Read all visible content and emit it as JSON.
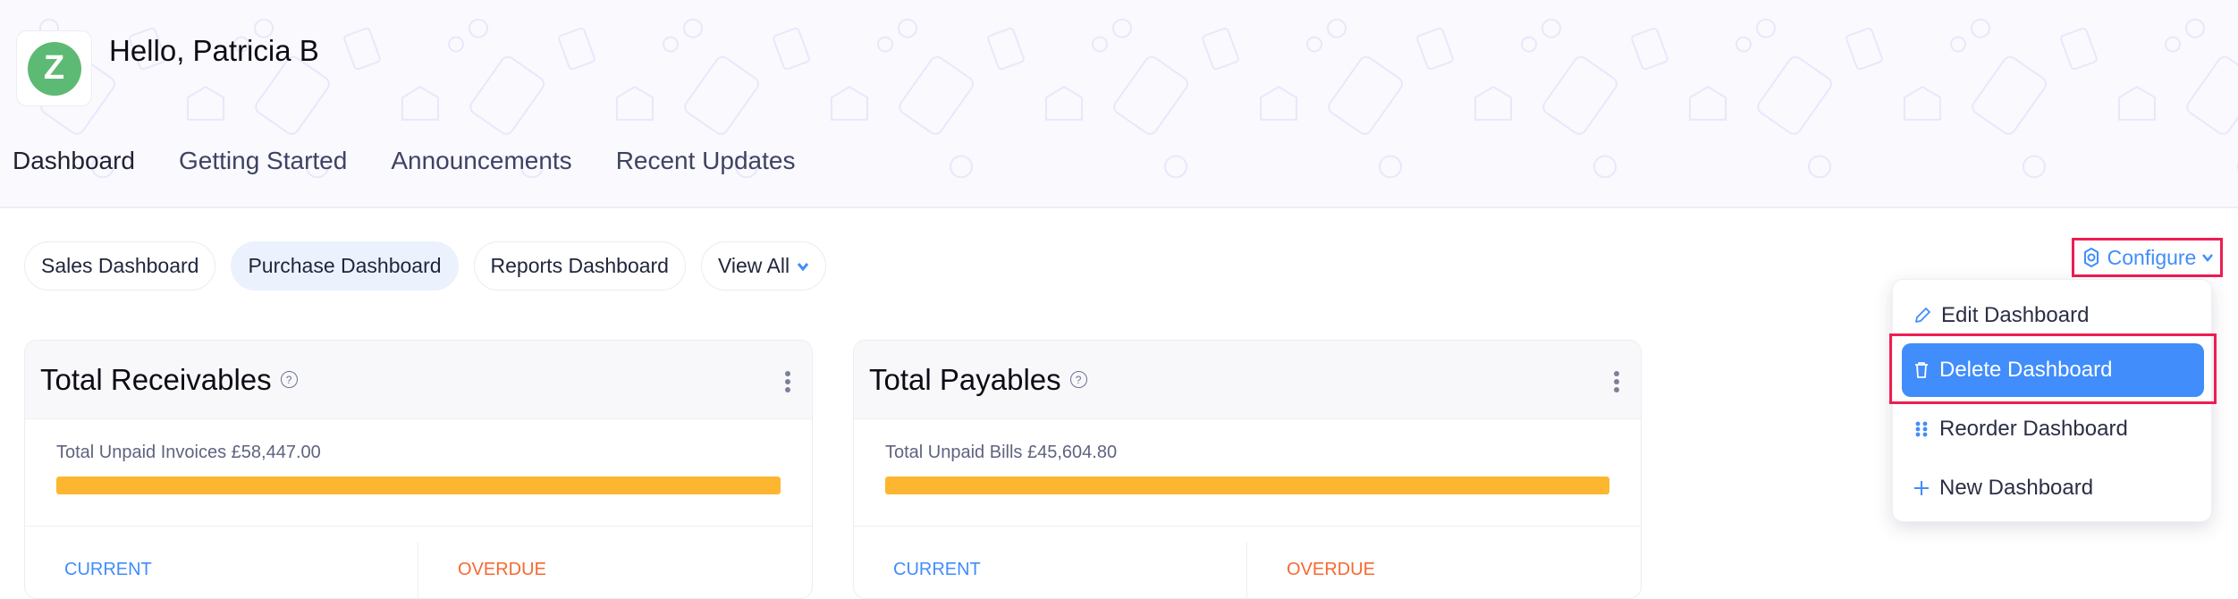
{
  "header": {
    "logo_letter": "Z",
    "greeting": "Hello, Patricia B"
  },
  "tabs": [
    {
      "label": "Dashboard",
      "active": true
    },
    {
      "label": "Getting Started",
      "active": false
    },
    {
      "label": "Announcements",
      "active": false
    },
    {
      "label": "Recent Updates",
      "active": false
    }
  ],
  "dashboards": {
    "pills": [
      {
        "label": "Sales Dashboard",
        "selected": false
      },
      {
        "label": "Purchase Dashboard",
        "selected": true
      },
      {
        "label": "Reports Dashboard",
        "selected": false
      }
    ],
    "view_all": "View All"
  },
  "configure": {
    "label": "Configure",
    "icon": "gear-icon",
    "menu": [
      {
        "label": "Edit Dashboard",
        "icon": "pencil-icon",
        "highlighted": false
      },
      {
        "label": "Delete Dashboard",
        "icon": "trash-icon",
        "highlighted": true
      },
      {
        "label": "Reorder Dashboard",
        "icon": "drag-handle-icon",
        "highlighted": false
      },
      {
        "label": "New Dashboard",
        "icon": "plus-icon",
        "highlighted": false
      }
    ]
  },
  "cards": [
    {
      "title": "Total Receivables",
      "help": "?",
      "unpaid_label": "Total Unpaid Invoices £58,447.00",
      "progress_percent": 100,
      "current_label": "CURRENT",
      "overdue_label": "OVERDUE"
    },
    {
      "title": "Total Payables",
      "help": "?",
      "unpaid_label": "Total Unpaid Bills £45,604.80",
      "progress_percent": 100,
      "current_label": "CURRENT",
      "overdue_label": "OVERDUE"
    }
  ],
  "colors": {
    "accent": "#408dfb",
    "highlight_frame": "#ee1d52",
    "progress": "#fdb62f",
    "overdue": "#f76831",
    "logo_green": "#5dba74"
  }
}
